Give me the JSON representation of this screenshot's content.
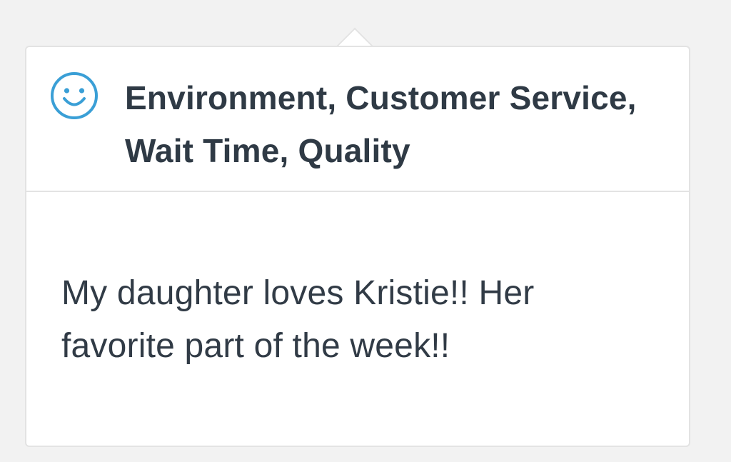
{
  "review": {
    "categories": "Environment, Customer Service, Wait Time, Quality",
    "comment": "My daughter loves Kristie!! Her favorite part of the week!!",
    "sentiment_icon": "smiley-face-icon",
    "accent_color": "#3a9fd6"
  }
}
